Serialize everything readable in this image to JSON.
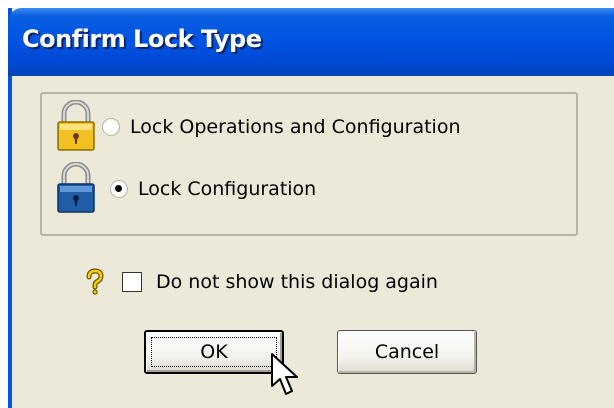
{
  "dialog": {
    "title": "Confirm Lock Type",
    "options": [
      {
        "label": "Lock Operations and Configuration",
        "icon": "lock-operations-icon",
        "selected": false
      },
      {
        "label": "Lock Configuration",
        "icon": "lock-configuration-icon",
        "selected": true
      }
    ],
    "dont_show_again": {
      "label": "Do not show this dialog again",
      "checked": false,
      "icon": "help-question-icon"
    },
    "buttons": {
      "ok": "OK",
      "cancel": "Cancel"
    }
  },
  "colors": {
    "titlebar": "#0054e3",
    "dialog_bg": "#ece9d8",
    "lock_yellow": "#f2c020",
    "lock_blue": "#1f5fa8"
  }
}
